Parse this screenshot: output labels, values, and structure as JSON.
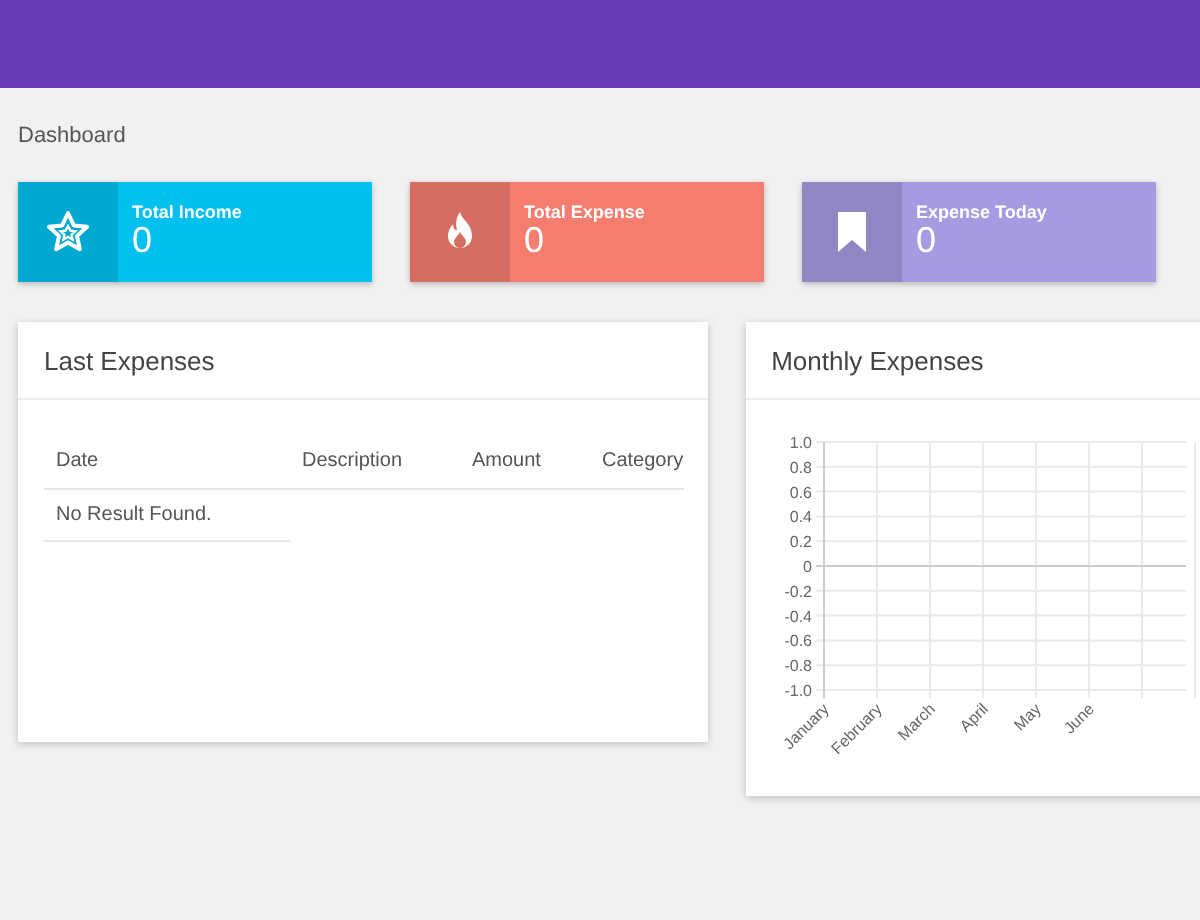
{
  "page": {
    "title": "Dashboard"
  },
  "stats": [
    {
      "kind": "star",
      "label": "Total Income",
      "value": "0",
      "color": "#00c0ef"
    },
    {
      "kind": "flame",
      "label": "Total Expense",
      "value": "0",
      "color": "#f57d70"
    },
    {
      "kind": "bookmark",
      "label": "Expense Today",
      "value": "0",
      "color": "#a49be0"
    }
  ],
  "last_expenses": {
    "title": "Last Expenses",
    "columns": [
      "Date",
      "Description",
      "Amount",
      "Category"
    ],
    "empty_message": "No Result Found."
  },
  "monthly_expenses": {
    "title": "Monthly Expenses",
    "chart_data": {
      "type": "line",
      "grid": true,
      "categories": [
        "January",
        "February",
        "March",
        "April",
        "May",
        "June"
      ],
      "ylim": [
        -1,
        1
      ],
      "yticks": [
        {
          "value": 1,
          "label": "1.0"
        },
        {
          "value": 0.8,
          "label": "0.8"
        },
        {
          "value": 0.6,
          "label": "0.6"
        },
        {
          "value": 0.4,
          "label": "0.4"
        },
        {
          "value": 0.2,
          "label": "0.2"
        },
        {
          "value": 0,
          "label": "0"
        },
        {
          "value": -0.2,
          "label": "-0.2"
        },
        {
          "value": -0.4,
          "label": "-0.4"
        },
        {
          "value": -0.6,
          "label": "-0.6"
        },
        {
          "value": -0.8,
          "label": "-0.8"
        },
        {
          "value": -1,
          "label": "-1.0"
        }
      ]
    }
  }
}
